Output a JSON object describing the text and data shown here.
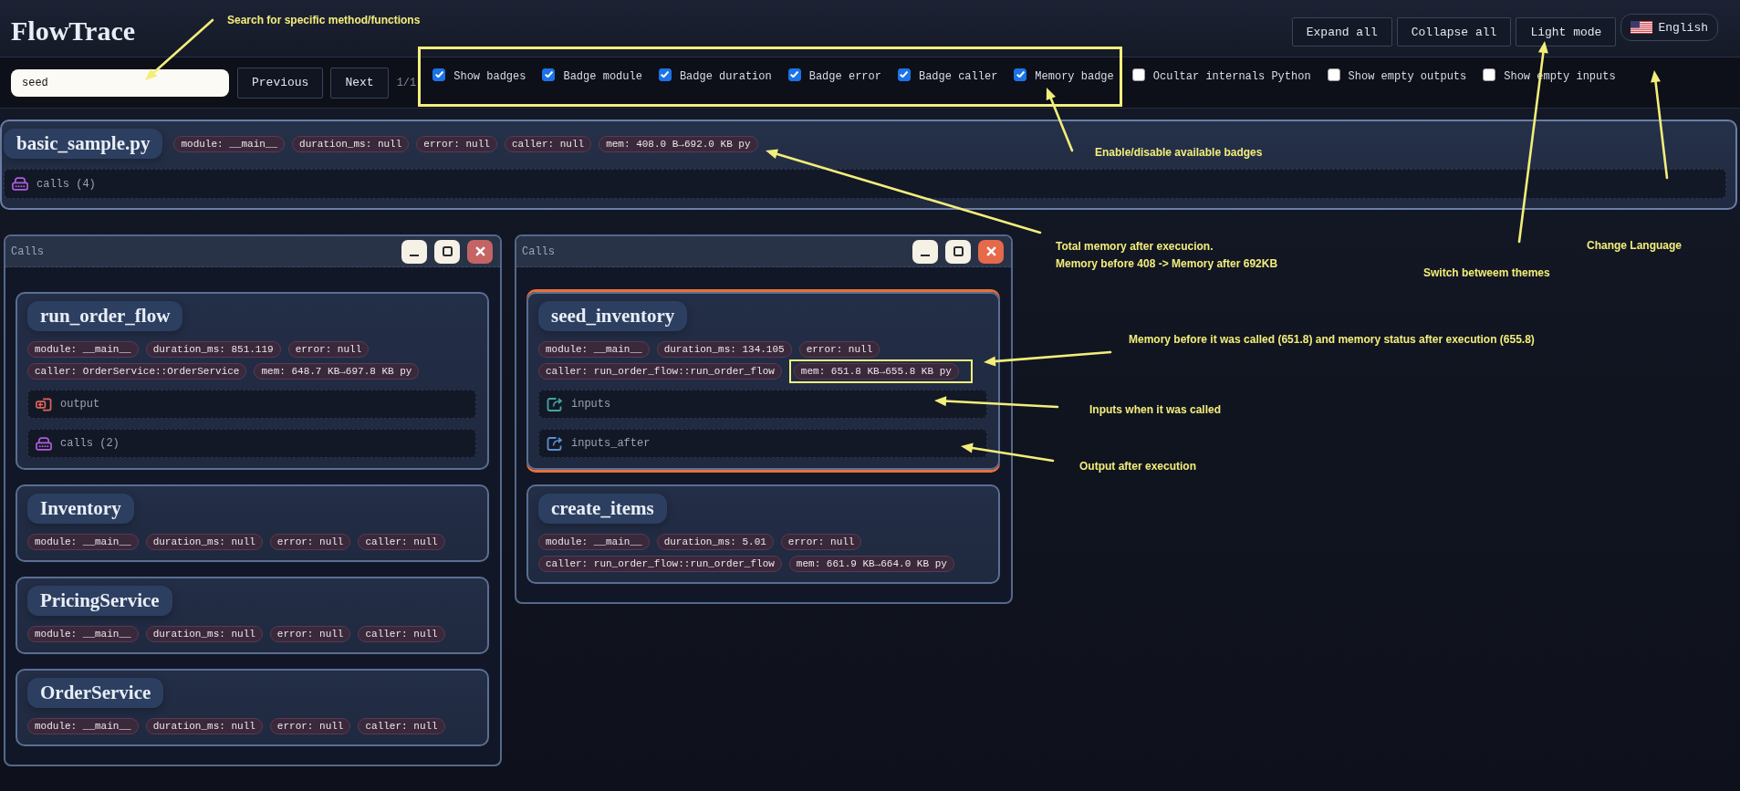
{
  "header": {
    "title": "FlowTrace",
    "buttons": [
      {
        "label": "Expand all"
      },
      {
        "label": "Collapse all"
      },
      {
        "label": "Light mode"
      }
    ],
    "language": {
      "label": "English"
    }
  },
  "toolbar": {
    "search": {
      "value": "seed"
    },
    "buttons": [
      {
        "label": "Previous"
      },
      {
        "label": "Next"
      }
    ],
    "match_count": "1/1",
    "badge_filters": {
      "outlined": true,
      "options": [
        {
          "label": "Show badges",
          "checked": true
        },
        {
          "label": "Badge module",
          "checked": true
        },
        {
          "label": "Badge duration",
          "checked": true
        },
        {
          "label": "Badge error",
          "checked": true
        },
        {
          "label": "Badge caller",
          "checked": true
        },
        {
          "label": "Memory badge",
          "checked": true
        }
      ]
    },
    "other_filters": [
      {
        "label": "Ocultar internals Python",
        "checked": false
      },
      {
        "label": "Show empty outputs",
        "checked": false
      },
      {
        "label": "Show empty inputs",
        "checked": false
      }
    ]
  },
  "root": {
    "name": "basic_sample.py",
    "badges": [
      {
        "text": "module: __main__",
        "outlined": false
      },
      {
        "text": "duration_ms: null",
        "outlined": false
      },
      {
        "text": "error: null",
        "outlined": false
      },
      {
        "text": "caller: null",
        "outlined": false
      },
      {
        "text": "mem: 408.0 B→692.0 KB py",
        "outlined": false
      }
    ],
    "sections": [
      {
        "kind": "calls",
        "label": "calls (4)"
      }
    ]
  },
  "panels": [
    {
      "title": "Calls",
      "focused": false,
      "nodes": [
        {
          "name": "run_order_flow",
          "highlighted": false,
          "badges": [
            {
              "text": "module: __main__",
              "outlined": false
            },
            {
              "text": "duration_ms: 851.119",
              "outlined": false
            },
            {
              "text": "error: null",
              "outlined": false
            },
            {
              "text": "caller: OrderService::OrderService",
              "outlined": false
            },
            {
              "text": "mem: 648.7 KB→697.8 KB py",
              "outlined": false
            }
          ],
          "sections": [
            {
              "kind": "output",
              "label": "output"
            },
            {
              "kind": "calls",
              "label": "calls (2)"
            }
          ]
        },
        {
          "name": "Inventory",
          "highlighted": false,
          "badges": [
            {
              "text": "module: __main__",
              "outlined": false
            },
            {
              "text": "duration_ms: null",
              "outlined": false
            },
            {
              "text": "error: null",
              "outlined": false
            },
            {
              "text": "caller: null",
              "outlined": false
            }
          ]
        },
        {
          "name": "PricingService",
          "highlighted": false,
          "badges": [
            {
              "text": "module: __main__",
              "outlined": false
            },
            {
              "text": "duration_ms: null",
              "outlined": false
            },
            {
              "text": "error: null",
              "outlined": false
            },
            {
              "text": "caller: null",
              "outlined": false
            }
          ]
        },
        {
          "name": "OrderService",
          "highlighted": false,
          "badges": [
            {
              "text": "module: __main__",
              "outlined": false
            },
            {
              "text": "duration_ms: null",
              "outlined": false
            },
            {
              "text": "error: null",
              "outlined": false
            },
            {
              "text": "caller: null",
              "outlined": false
            }
          ]
        }
      ]
    },
    {
      "title": "Calls",
      "focused": true,
      "nodes": [
        {
          "name": "seed_inventory",
          "highlighted": true,
          "badges": [
            {
              "text": "module: __main__",
              "outlined": false
            },
            {
              "text": "duration_ms: 134.105",
              "outlined": false
            },
            {
              "text": "error: null",
              "outlined": false
            },
            {
              "text": "caller: run_order_flow::run_order_flow",
              "outlined": false
            },
            {
              "text": "mem: 651.8 KB→655.8 KB py",
              "outlined": true
            }
          ],
          "sections": [
            {
              "kind": "input",
              "label": "inputs"
            },
            {
              "kind": "after",
              "label": "inputs_after"
            }
          ]
        },
        {
          "name": "create_items",
          "highlighted": false,
          "badges": [
            {
              "text": "module: __main__",
              "outlined": false
            },
            {
              "text": "duration_ms: 5.01",
              "outlined": false
            },
            {
              "text": "error: null",
              "outlined": false
            },
            {
              "text": "caller: run_order_flow::run_order_flow",
              "outlined": false
            },
            {
              "text": "mem: 661.9 KB→664.0 KB py",
              "outlined": false
            }
          ]
        }
      ]
    }
  ],
  "annotations": [
    {
      "lines": [
        "Search for specific method/functions"
      ]
    },
    {
      "lines": [
        "Enable/disable available badges"
      ]
    },
    {
      "lines": [
        "Total memory after execucion.",
        "Memory before 408 -> Memory after 692KB"
      ]
    },
    {
      "lines": [
        "Change Language"
      ]
    },
    {
      "lines": [
        "Switch betweem themes"
      ]
    },
    {
      "lines": [
        "Memory before it was called (651.8) and memory status after execution (655.8)"
      ]
    },
    {
      "lines": [
        "Inputs when it was called"
      ]
    },
    {
      "lines": [
        "Output after execution"
      ]
    }
  ]
}
